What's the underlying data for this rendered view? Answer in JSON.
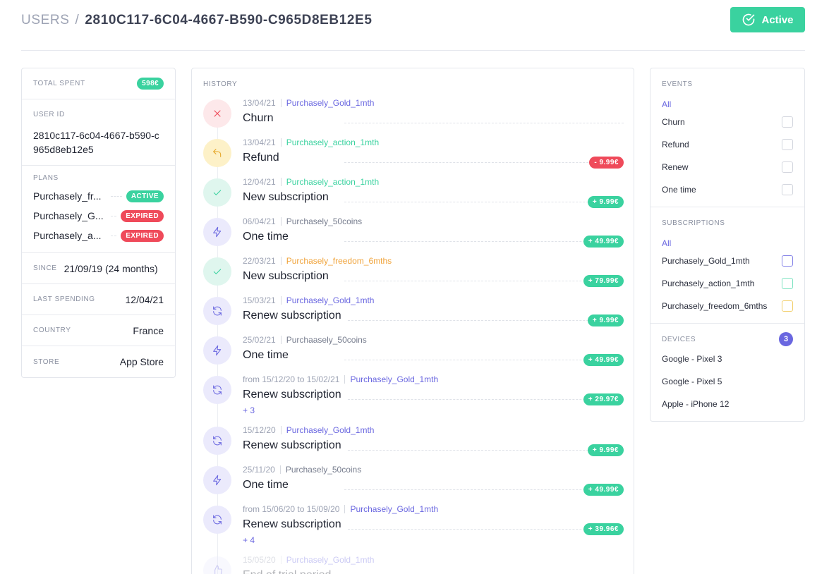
{
  "breadcrumb": {
    "root": "USERS",
    "separator": "/",
    "current": "2810C117-6C04-4667-B590-C965D8EB12E5"
  },
  "status_button": {
    "label": "Active",
    "icon": "check-circle-icon"
  },
  "summary": {
    "total_spent_label": "TOTAL SPENT",
    "total_spent_value": "598€",
    "user_id_label": "USER ID",
    "user_id_value": "2810c117-6c04-4667-b590-c965d8eb12e5",
    "plans_label": "PLANS",
    "plans": [
      {
        "name": "Purchasely_fr...",
        "status": "ACTIVE",
        "color": "#3ad29f"
      },
      {
        "name": "Purchasely_G...",
        "status": "EXPIRED",
        "color": "#ef4a5a"
      },
      {
        "name": "Purchasely_a...",
        "status": "EXPIRED",
        "color": "#ef4a5a"
      }
    ],
    "since_label": "SINCE",
    "since_value": "21/09/19 (24 months)",
    "last_spending_label": "LAST SPENDING",
    "last_spending_value": "12/04/21",
    "country_label": "COUNTRY",
    "country_value": "France",
    "store_label": "STORE",
    "store_value": "App Store"
  },
  "history": {
    "title": "HISTORY",
    "events": [
      {
        "date": "13/04/21",
        "product": "Purchasely_Gold_1mth",
        "product_color": "purple",
        "title": "Churn",
        "icon": "x-icon",
        "tone": "red",
        "amount": "",
        "more": ""
      },
      {
        "date": "13/04/21",
        "product": "Purchasely_action_1mth",
        "product_color": "green",
        "title": "Refund",
        "icon": "undo-arrow-icon",
        "tone": "yellow",
        "amount": "- 9.99€",
        "negative": true,
        "more": ""
      },
      {
        "date": "12/04/21",
        "product": "Purchasely_action_1mth",
        "product_color": "green",
        "title": "New subscription",
        "icon": "check-icon",
        "tone": "green",
        "amount": "+ 9.99€",
        "more": ""
      },
      {
        "date": "06/04/21",
        "product": "Purchasely_50coins",
        "product_color": "gray",
        "title": "One time",
        "icon": "lightning-icon",
        "tone": "purple",
        "amount": "+ 49.99€",
        "more": ""
      },
      {
        "date": "22/03/21",
        "product": "Purchasely_freedom_6mths",
        "product_color": "orange",
        "title": "New subscription",
        "icon": "check-icon",
        "tone": "green",
        "amount": "+ 79.99€",
        "more": ""
      },
      {
        "date": "15/03/21",
        "product": "Purchasely_Gold_1mth",
        "product_color": "purple",
        "title": "Renew subscription",
        "icon": "refresh-icon",
        "tone": "purple",
        "amount": "+ 9.99€",
        "more": ""
      },
      {
        "date": "25/02/21",
        "product": "Purchaasely_50coins",
        "product_color": "gray",
        "title": "One time",
        "icon": "lightning-icon",
        "tone": "purple",
        "amount": "+ 49.99€",
        "more": ""
      },
      {
        "date": "from 15/12/20 to 15/02/21",
        "product": "Purchasely_Gold_1mth",
        "product_color": "purple",
        "title": "Renew subscription",
        "icon": "refresh-icon",
        "tone": "purple",
        "amount": "+ 29.97€",
        "more": "+ 3"
      },
      {
        "date": "15/12/20",
        "product": "Purchasely_Gold_1mth",
        "product_color": "purple",
        "title": "Renew subscription",
        "icon": "refresh-icon",
        "tone": "purple",
        "amount": "+ 9.99€",
        "more": ""
      },
      {
        "date": "25/11/20",
        "product": "Purchasely_50coins",
        "product_color": "gray",
        "title": "One time",
        "icon": "lightning-icon",
        "tone": "purple",
        "amount": "+ 49.99€",
        "more": ""
      },
      {
        "date": "from 15/06/20 to 15/09/20",
        "product": "Purchasely_Gold_1mth",
        "product_color": "purple",
        "title": "Renew subscription",
        "icon": "refresh-icon",
        "tone": "purple",
        "amount": "+ 39.96€",
        "more": "+ 4"
      },
      {
        "date": "15/05/20",
        "product": "Purchasely_Gold_1mth",
        "product_color": "purple",
        "title": "End of trial period",
        "icon": "thumbs-up-icon",
        "tone": "purple",
        "amount": "",
        "more": ""
      }
    ]
  },
  "filters": {
    "events_label": "EVENTS",
    "events_all": "All",
    "events": [
      "Churn",
      "Refund",
      "Renew",
      "One time"
    ],
    "subscriptions_label": "SUBSCRIPTIONS",
    "subscriptions_all": "All",
    "subscriptions": [
      {
        "name": "Purchasely_Gold_1mth",
        "color": "#8684e8"
      },
      {
        "name": "Purchasely_action_1mth",
        "color": "#7fe3c2"
      },
      {
        "name": "Purchasely_freedom_6mths",
        "color": "#f2cf6c"
      }
    ],
    "devices_label": "DEVICES",
    "devices_count": "3",
    "devices": [
      "Google - Pixel 3",
      "Google - Pixel 5",
      "Apple - iPhone 12"
    ]
  }
}
